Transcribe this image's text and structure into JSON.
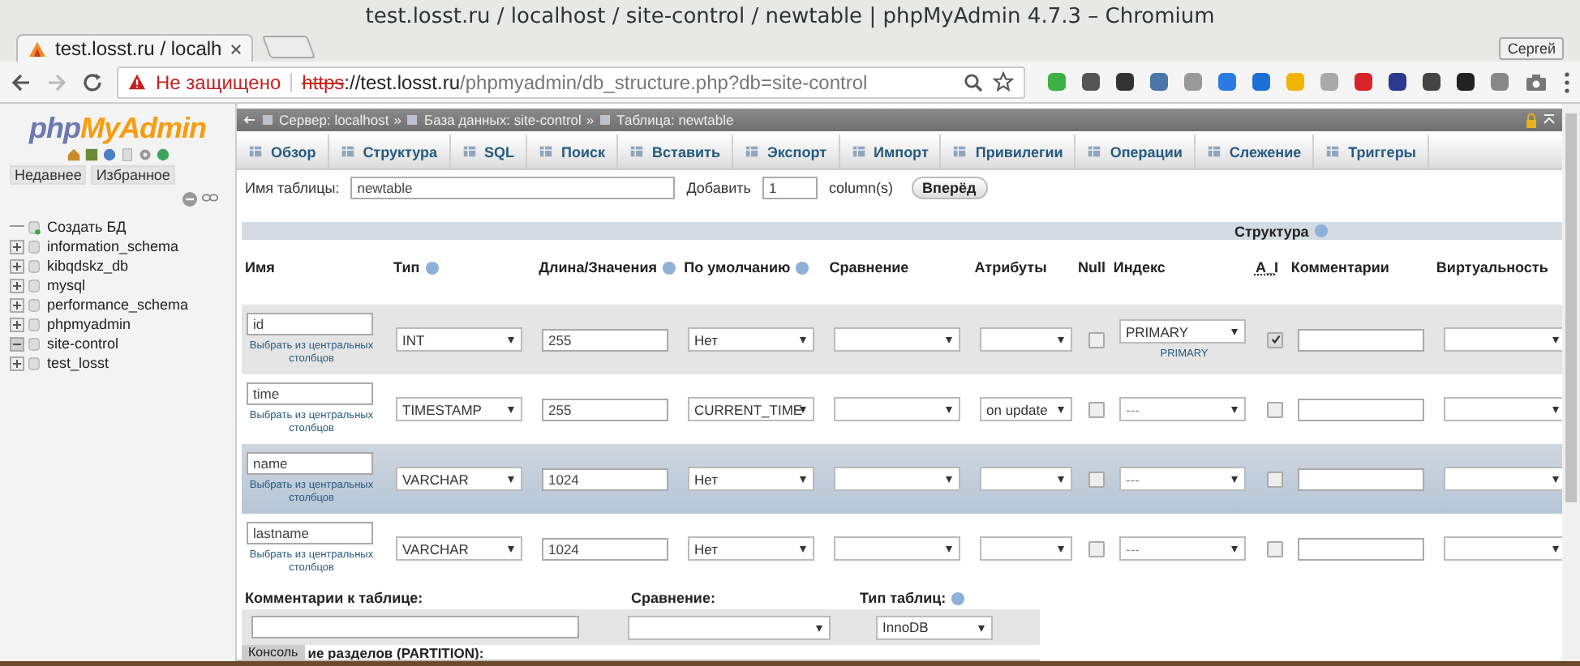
{
  "window": {
    "title": "test.losst.ru / localhost / site-control / newtable | phpMyAdmin 4.7.3 – Chromium"
  },
  "browser": {
    "tabs": [
      {
        "label": "test.losst.ru / localh",
        "selected": true
      }
    ],
    "profile": "Сергей",
    "security": "Не защищено",
    "url": {
      "scheme": "https",
      "host": "://test.losst.ru",
      "path": "/phpmyadmin/db_structure.php?db=site-control"
    }
  },
  "sidebar": {
    "logo": {
      "part_1": "php",
      "part_2": "MyAdmin"
    },
    "tabs": [
      "Недавнее",
      "Избранное"
    ],
    "tree": [
      {
        "kind": "new",
        "label": "Создать БД"
      },
      {
        "kind": "db",
        "label": "information_schema",
        "expanded": false
      },
      {
        "kind": "db",
        "label": "kibqdskz_db",
        "expanded": false
      },
      {
        "kind": "db",
        "label": "mysql",
        "expanded": false
      },
      {
        "kind": "db",
        "label": "performance_schema",
        "expanded": false
      },
      {
        "kind": "db",
        "label": "phpmyadmin",
        "expanded": false
      },
      {
        "kind": "db",
        "label": "site-control",
        "expanded": true
      },
      {
        "kind": "db",
        "label": "test_losst",
        "expanded": false
      }
    ]
  },
  "breadcrumb": {
    "separator": "»",
    "items": [
      "Сервер: localhost",
      "База данных: site-control",
      "Таблица: newtable"
    ]
  },
  "menu": [
    {
      "label": "Обзор",
      "selected": false
    },
    {
      "label": "Структура",
      "selected": false
    },
    {
      "label": "SQL",
      "selected": false
    },
    {
      "label": "Поиск",
      "selected": false
    },
    {
      "label": "Вставить",
      "selected": false
    },
    {
      "label": "Экспорт",
      "selected": false
    },
    {
      "label": "Импорт",
      "selected": false
    },
    {
      "label": "Привилегии",
      "selected": false
    },
    {
      "label": "Операции",
      "selected": false
    },
    {
      "label": "Слежение",
      "selected": false
    },
    {
      "label": "Триггеры",
      "selected": false
    }
  ],
  "table_form": {
    "name_label": "Имя таблицы:",
    "name_value": "newtable",
    "add_label": "Добавить",
    "add_value": "1",
    "add_unit": "column(s)",
    "go_button": "Вперёд"
  },
  "structure": {
    "title": "Структура",
    "columns": [
      {
        "label": "Имя"
      },
      {
        "label": "Тип",
        "help": true
      },
      {
        "label": "Длина/Значения",
        "help": true
      },
      {
        "label": "По умолчанию",
        "help": true
      },
      {
        "label": "Сравнение"
      },
      {
        "label": "Атрибуты"
      },
      {
        "label": "Null"
      },
      {
        "label": "Индекс"
      },
      {
        "label": "A_I",
        "abbr": true
      },
      {
        "label": "Комментарии"
      },
      {
        "label": "Виртуальность"
      }
    ],
    "rows": [
      {
        "name": "id",
        "central_link": "Выбрать из центральных столбцов",
        "type": "INT",
        "length": "255",
        "default": "Нет",
        "null": false,
        "index": "PRIMARY",
        "index_note": "PRIMARY",
        "ai": true,
        "highlighted": false
      },
      {
        "name": "time",
        "central_link": "Выбрать из центральных столбцов",
        "type": "TIMESTAMP",
        "length": "255",
        "default": "CURRENT_TIME",
        "attributes": "on update",
        "null": false,
        "index": "---",
        "ai": false,
        "highlighted": false
      },
      {
        "name": "name",
        "central_link": "Выбрать из центральных столбцов",
        "type": "VARCHAR",
        "length": "1024",
        "default": "Нет",
        "null": false,
        "index": "---",
        "ai": false,
        "highlighted": true
      },
      {
        "name": "lastname",
        "central_link": "Выбрать из центральных столбцов",
        "type": "VARCHAR",
        "length": "1024",
        "default": "Нет",
        "null": false,
        "index": "---",
        "ai": false,
        "highlighted": false
      }
    ]
  },
  "footer": {
    "comment_label": "Комментарии к таблице:",
    "collation_label": "Сравнение:",
    "engine_label": "Тип таблиц:",
    "engine": "InnoDB",
    "partition_label": "ие разделов (PARTITION):",
    "console": "Консоль"
  }
}
